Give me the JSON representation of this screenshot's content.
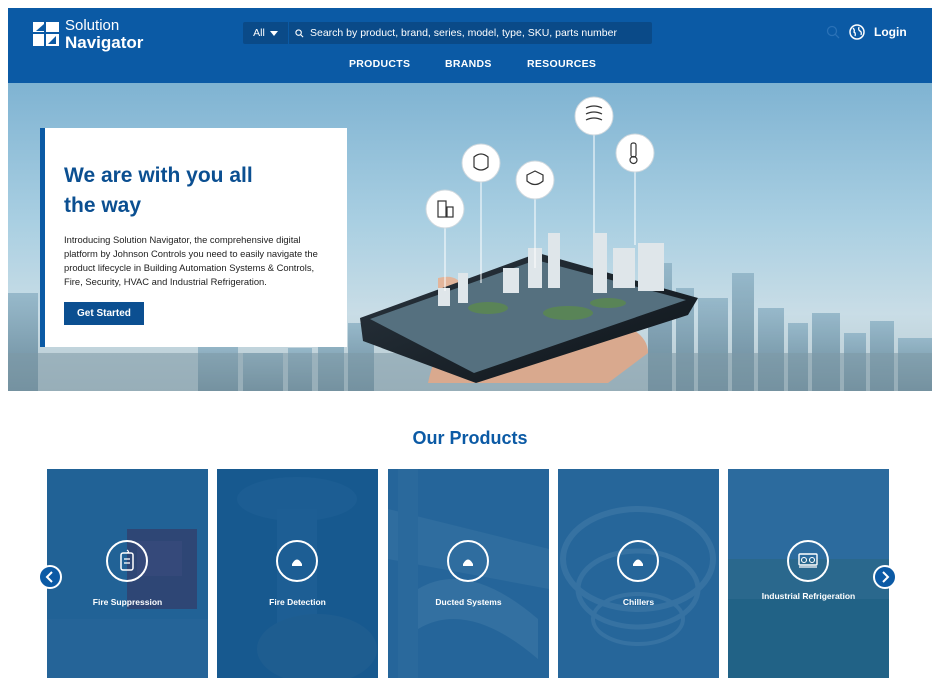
{
  "header": {
    "logo_line1": "Solution",
    "logo_line2": "Navigator",
    "search_category": "All",
    "search_placeholder": "Search by product, brand, series, model, type, SKU, parts number",
    "login_label": "Login"
  },
  "nav": {
    "items": [
      {
        "label": "PRODUCTS"
      },
      {
        "label": "BRANDS"
      },
      {
        "label": "RESOURCES"
      }
    ]
  },
  "hero": {
    "title": "We are with you all the way",
    "body": "Introducing Solution Navigator, the comprehensive digital platform by Johnson Controls you need to easily navigate the product lifecycle in Building Automation Systems & Controls, Fire, Security, HVAC and Industrial Refrigeration.",
    "cta_label": "Get Started"
  },
  "products": {
    "title": "Our Products",
    "cards": [
      {
        "label": "Fire Suppression",
        "icon": "fire-suppression-icon"
      },
      {
        "label": "Fire Detection",
        "icon": "fire-detection-icon"
      },
      {
        "label": "Ducted Systems",
        "icon": "ducted-systems-icon"
      },
      {
        "label": "Chillers",
        "icon": "chillers-icon"
      },
      {
        "label": "Industrial Refrigeration",
        "icon": "industrial-refrigeration-icon"
      }
    ]
  },
  "colors": {
    "brand_blue": "#0b5aa5",
    "dark_blue": "#0b4f91"
  }
}
